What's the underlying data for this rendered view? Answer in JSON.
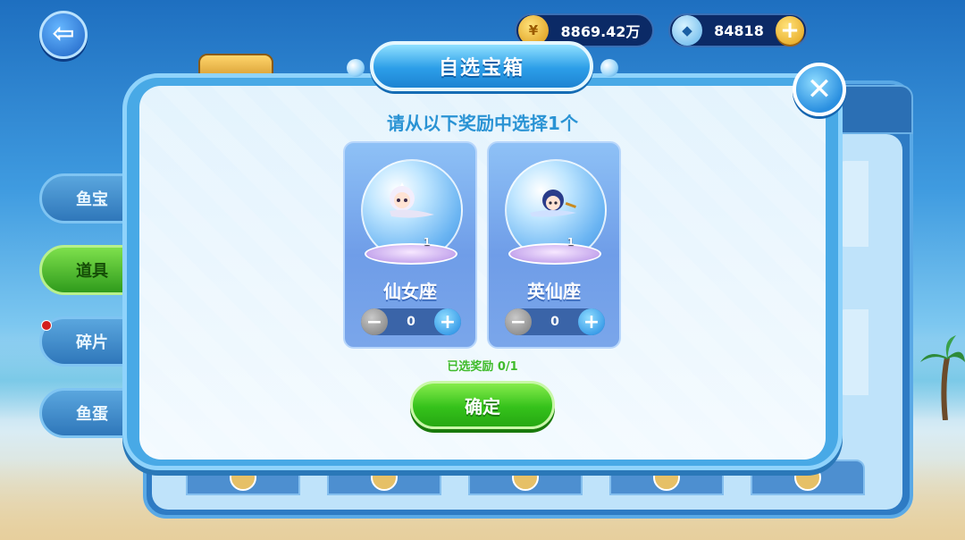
{
  "header": {
    "gold_amount": "8869.42万",
    "gem_amount": "84818",
    "gold_icon": "gold-coin-icon",
    "gem_icon": "diamond-icon"
  },
  "sidebar": {
    "items": [
      {
        "label": "鱼宝",
        "active": false
      },
      {
        "label": "道具",
        "active": true
      },
      {
        "label": "碎片",
        "active": false,
        "badge": true
      },
      {
        "label": "鱼蛋",
        "active": false
      }
    ]
  },
  "dialog": {
    "title": "自选宝箱",
    "prompt": "请从以下奖励中选择1个",
    "rewards": [
      {
        "name": "仙女座",
        "count": "1",
        "selected": "0"
      },
      {
        "name": "英仙座",
        "count": "1",
        "selected": "0"
      }
    ],
    "selected_summary": "已选奖励 0/1",
    "confirm_label": "确定"
  },
  "colors": {
    "accent_blue": "#2a93d4",
    "confirm_green": "#35c21b",
    "selected_text_green": "#3fbb2a"
  }
}
